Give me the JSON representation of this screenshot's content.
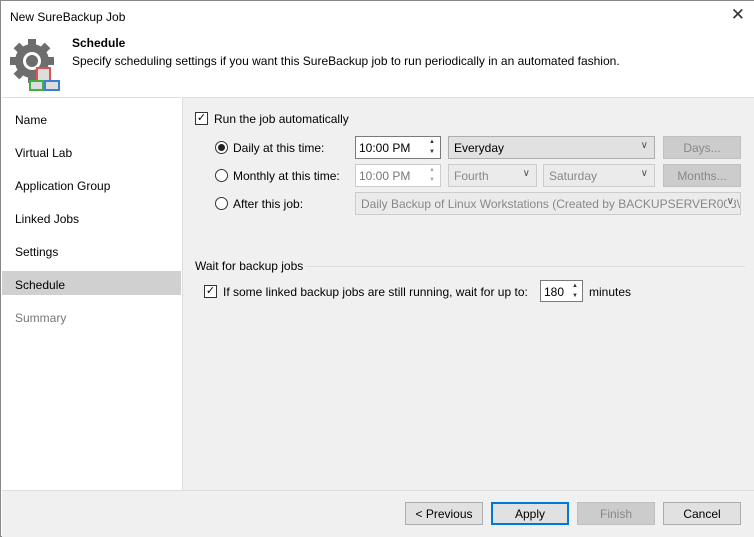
{
  "window": {
    "title": "New SureBackup Job"
  },
  "header": {
    "title": "Schedule",
    "description": "Specify scheduling settings if you want this SureBackup job to run periodically in an automated fashion."
  },
  "sidebar": {
    "items": [
      {
        "label": "Name"
      },
      {
        "label": "Virtual Lab"
      },
      {
        "label": "Application Group"
      },
      {
        "label": "Linked Jobs"
      },
      {
        "label": "Settings"
      },
      {
        "label": "Schedule"
      },
      {
        "label": "Summary"
      }
    ]
  },
  "schedule": {
    "run_auto_label": "Run the job automatically",
    "run_auto_checked": true,
    "daily_label": "Daily at this time:",
    "daily_time": "10:00 PM",
    "daily_option": "Everyday",
    "days_button": "Days...",
    "monthly_label": "Monthly at this time:",
    "monthly_time": "10:00 PM",
    "monthly_week": "Fourth",
    "monthly_day": "Saturday",
    "months_button": "Months...",
    "after_label": "After this job:",
    "after_job": "Daily Backup of Linux Workstations (Created by BACKUPSERVER003\\"
  },
  "wait": {
    "section_title": "Wait for backup jobs",
    "label": "If some linked backup jobs are still running, wait for up to:",
    "checked": true,
    "value": "180",
    "unit": "minutes"
  },
  "footer": {
    "previous": "< Previous",
    "apply": "Apply",
    "finish": "Finish",
    "cancel": "Cancel"
  }
}
